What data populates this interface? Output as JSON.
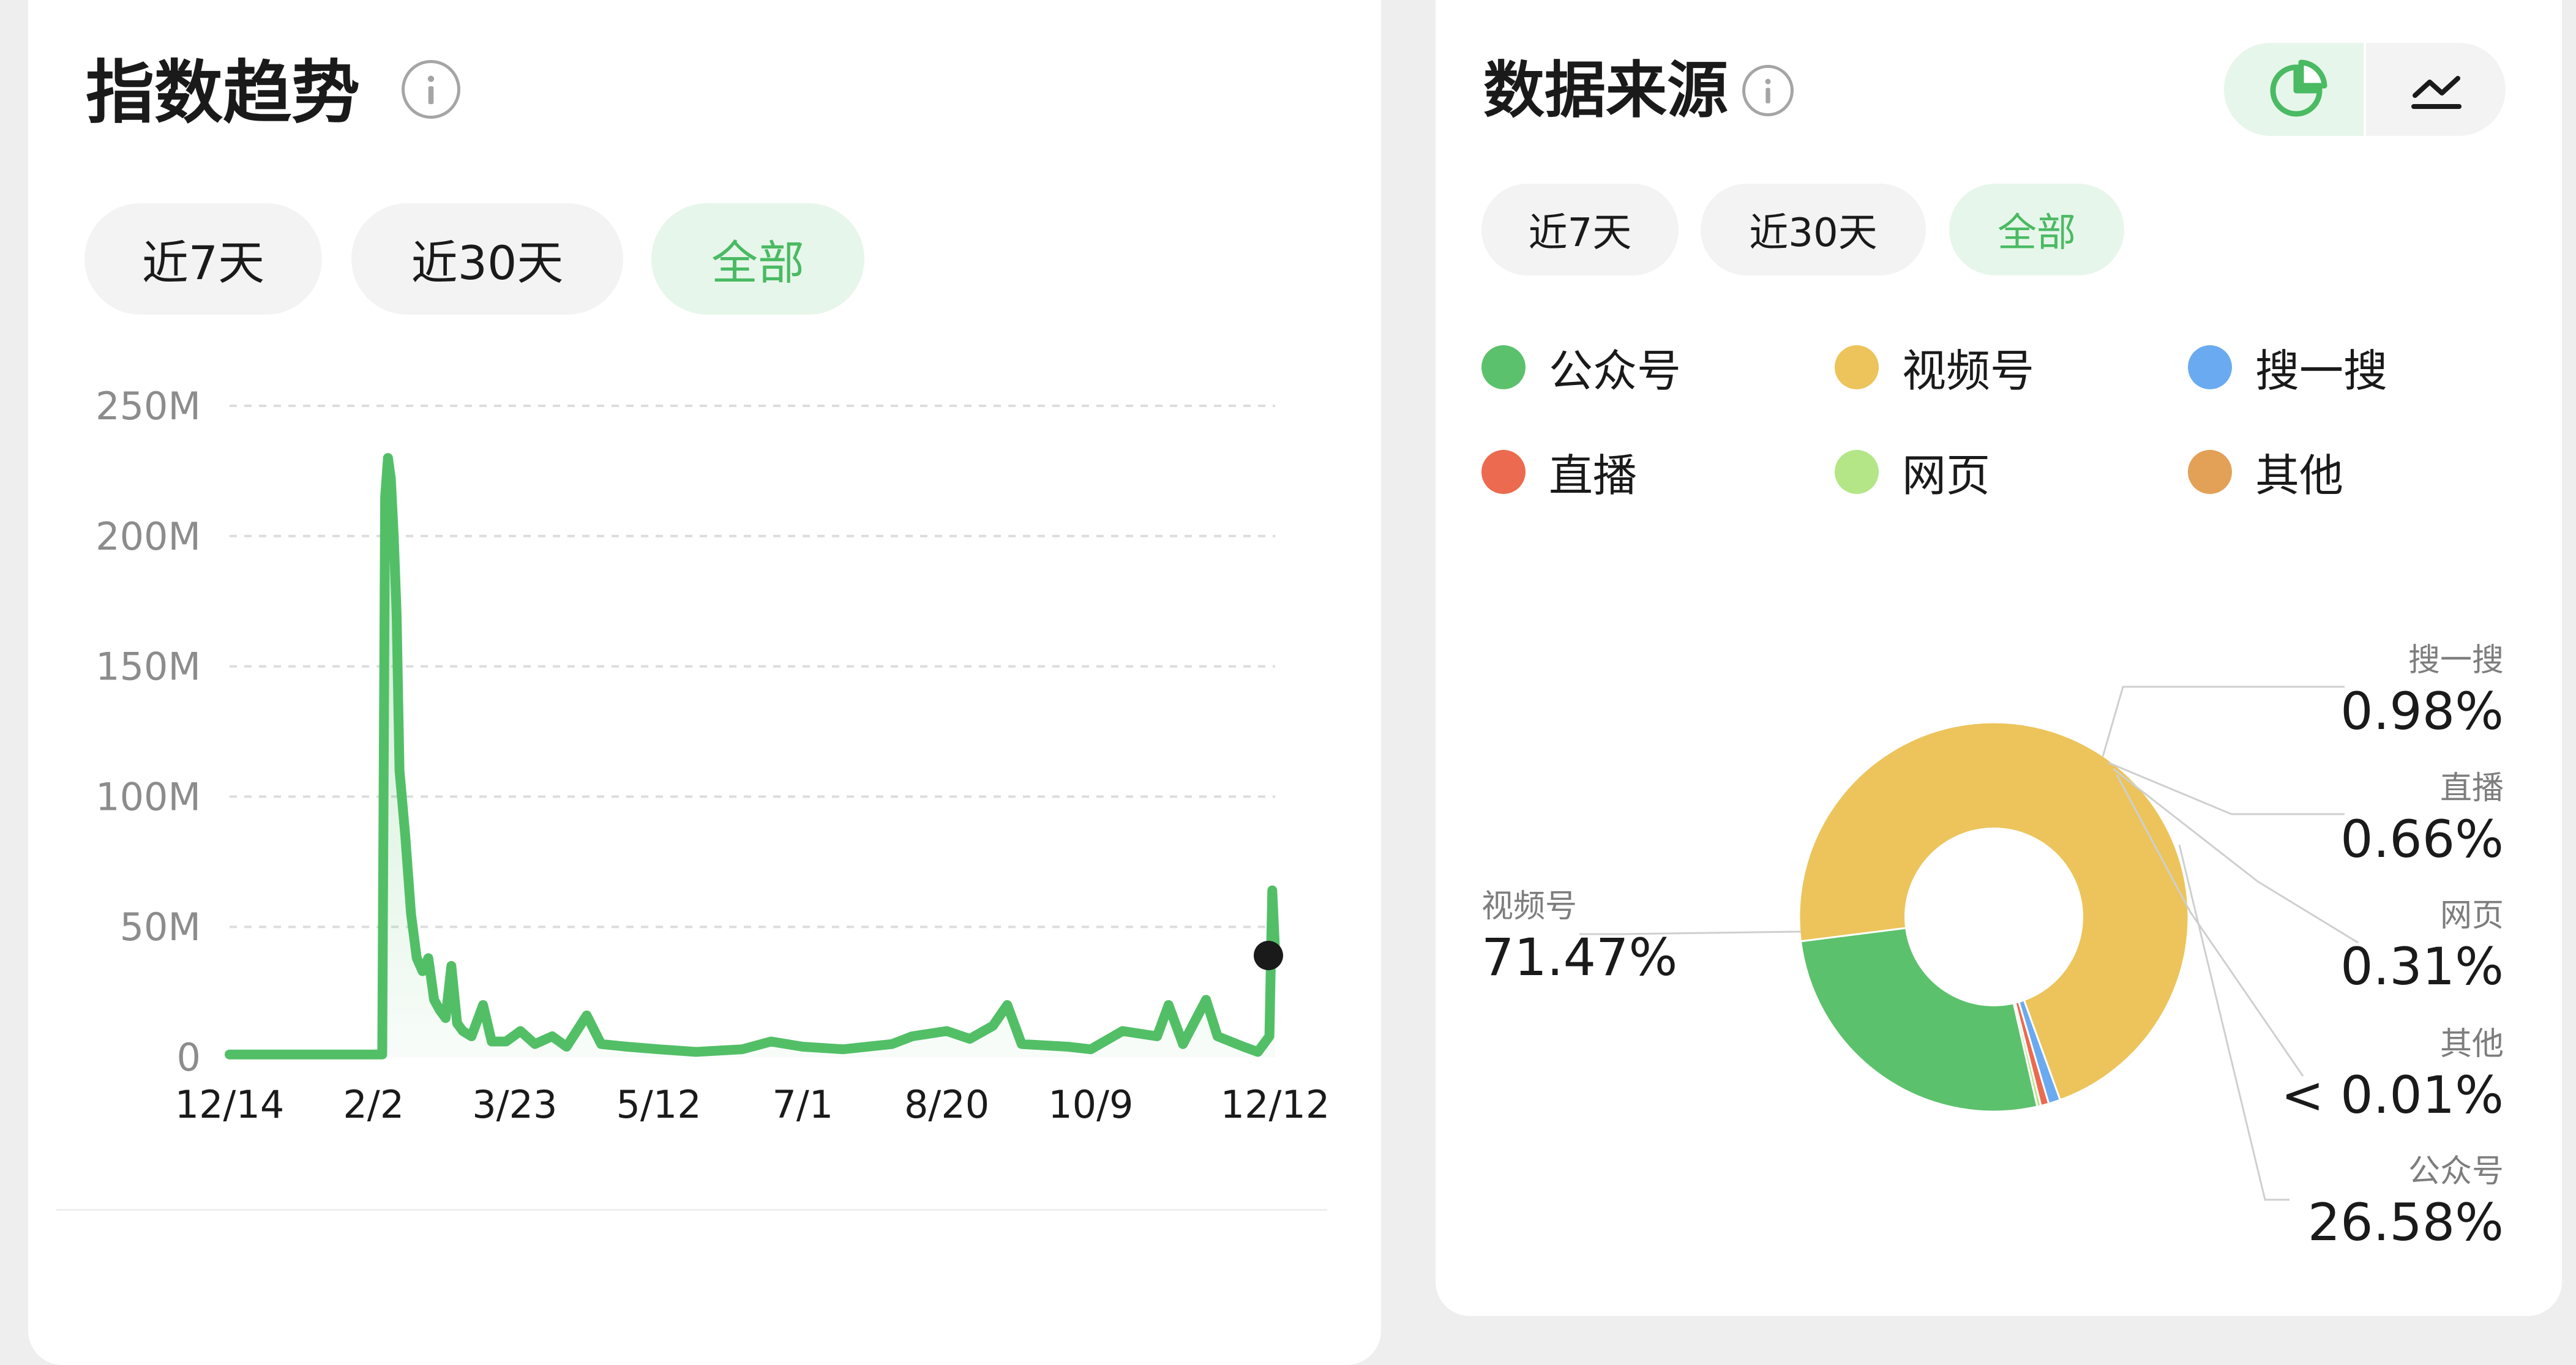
{
  "index_trend": {
    "title": "指数趋势",
    "info_icon": "info-icon",
    "filters": [
      {
        "label": "近7天",
        "active": false
      },
      {
        "label": "近30天",
        "active": false
      },
      {
        "label": "全部",
        "active": true
      }
    ],
    "chart_data": {
      "type": "area",
      "title": "",
      "xlabel": "",
      "ylabel": "",
      "y_ticks": [
        "250M",
        "200M",
        "150M",
        "100M",
        "50M",
        "0"
      ],
      "x_ticks": [
        "12/14",
        "2/2",
        "3/23",
        "5/12",
        "7/1",
        "8/20",
        "10/9",
        "12/12"
      ],
      "ylim": [
        0,
        250000000
      ],
      "grid": true,
      "series": [
        {
          "color": "#52bf67",
          "points": [
            [
              "12/14",
              1000000
            ],
            [
              "1/1",
              1000000
            ],
            [
              "1/20",
              1000000
            ],
            [
              "2/3",
              1000000
            ],
            [
              "2/5",
              1000000
            ],
            [
              "2/6",
              215000000
            ],
            [
              "2/7",
              230000000
            ],
            [
              "2/8",
              222000000
            ],
            [
              "2/9",
              200000000
            ],
            [
              "2/10",
              170000000
            ],
            [
              "2/11",
              110000000
            ],
            [
              "2/13",
              85000000
            ],
            [
              "2/15",
              55000000
            ],
            [
              "2/17",
              38000000
            ],
            [
              "2/19",
              33000000
            ],
            [
              "2/21",
              38000000
            ],
            [
              "2/23",
              22000000
            ],
            [
              "2/25",
              18000000
            ],
            [
              "2/27",
              15000000
            ],
            [
              "3/1",
              35000000
            ],
            [
              "3/3",
              13000000
            ],
            [
              "3/5",
              10000000
            ],
            [
              "3/8",
              8000000
            ],
            [
              "3/12",
              20000000
            ],
            [
              "3/15",
              6000000
            ],
            [
              "3/20",
              6000000
            ],
            [
              "3/25",
              10000000
            ],
            [
              "3/30",
              5000000
            ],
            [
              "4/5",
              8000000
            ],
            [
              "4/10",
              4000000
            ],
            [
              "4/17",
              16000000
            ],
            [
              "4/22",
              5000000
            ],
            [
              "5/1",
              4000000
            ],
            [
              "5/12",
              3000000
            ],
            [
              "5/25",
              2000000
            ],
            [
              "6/10",
              3000000
            ],
            [
              "6/20",
              6000000
            ],
            [
              "7/1",
              4000000
            ],
            [
              "7/15",
              3000000
            ],
            [
              "8/1",
              5000000
            ],
            [
              "8/8",
              8000000
            ],
            [
              "8/20",
              10000000
            ],
            [
              "8/28",
              7000000
            ],
            [
              "9/5",
              12000000
            ],
            [
              "9/10",
              20000000
            ],
            [
              "9/15",
              5000000
            ],
            [
              "10/1",
              4000000
            ],
            [
              "10/9",
              3000000
            ],
            [
              "10/20",
              10000000
            ],
            [
              "11/1",
              8000000
            ],
            [
              "11/5",
              20000000
            ],
            [
              "11/10",
              5000000
            ],
            [
              "11/18",
              22000000
            ],
            [
              "11/22",
              8000000
            ],
            [
              "12/1",
              4000000
            ],
            [
              "12/6",
              2000000
            ],
            [
              "12/10",
              8000000
            ],
            [
              "12/11",
              64000000
            ],
            [
              "12/12",
              40000000
            ]
          ]
        }
      ],
      "current_point_color": "#1a1a1a"
    }
  },
  "data_source": {
    "title": "数据来源",
    "info_icon": "info-icon",
    "view_toggle": [
      {
        "icon": "pie-chart-icon",
        "active": true
      },
      {
        "icon": "line-chart-icon",
        "active": false
      }
    ],
    "filters": [
      {
        "label": "近7天",
        "active": false
      },
      {
        "label": "近30天",
        "active": false
      },
      {
        "label": "全部",
        "active": true
      }
    ],
    "legend": [
      {
        "label": "公众号",
        "color": "#5cc16c"
      },
      {
        "label": "视频号",
        "color": "#ecc45b"
      },
      {
        "label": "搜一搜",
        "color": "#6aaaf0"
      },
      {
        "label": "直播",
        "color": "#ec6a4f"
      },
      {
        "label": "网页",
        "color": "#b4e688"
      },
      {
        "label": "其他",
        "color": "#e3a057"
      }
    ],
    "chart_data": {
      "type": "pie",
      "donut": true,
      "slices": [
        {
          "label": "视频号",
          "percent": 71.47,
          "display": "71.47%",
          "color": "#ecc45b"
        },
        {
          "label": "搜一搜",
          "percent": 0.98,
          "display": "0.98%",
          "color": "#6aaaf0"
        },
        {
          "label": "直播",
          "percent": 0.66,
          "display": "0.66%",
          "color": "#ec6a4f"
        },
        {
          "label": "网页",
          "percent": 0.31,
          "display": "0.31%",
          "color": "#b4e688"
        },
        {
          "label": "其他",
          "percent": 0.005,
          "display": "< 0.01%",
          "color": "#e3a057"
        },
        {
          "label": "公众号",
          "percent": 26.58,
          "display": "26.58%",
          "color": "#5cc16c"
        }
      ]
    }
  }
}
